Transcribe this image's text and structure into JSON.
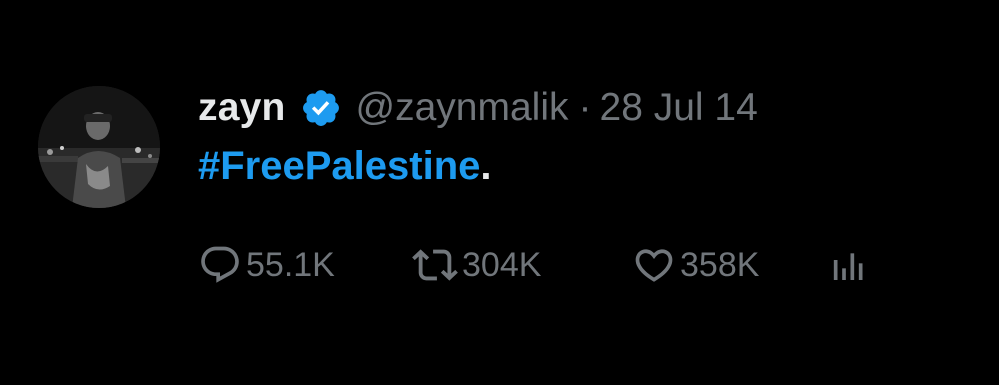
{
  "tweet": {
    "author": {
      "name": "zayn",
      "handle": "@zaynmalik",
      "verified": true,
      "avatar": "profile-photo"
    },
    "separator": "·",
    "date": "28 Jul 14",
    "text": {
      "hashtag": "#FreePalestine",
      "trailing": "."
    },
    "metrics": {
      "replies": "55.1K",
      "retweets": "304K",
      "likes": "358K"
    },
    "icons": {
      "reply": "speech-bubble-icon",
      "retweet": "retweet-arrows-icon",
      "like": "heart-icon",
      "views": "bar-chart-icon",
      "verified": "verified-badge-icon"
    },
    "colors": {
      "background": "#000000",
      "primary_text": "#e7e9ea",
      "secondary_text": "#71767b",
      "accent": "#1d9bf0"
    }
  }
}
